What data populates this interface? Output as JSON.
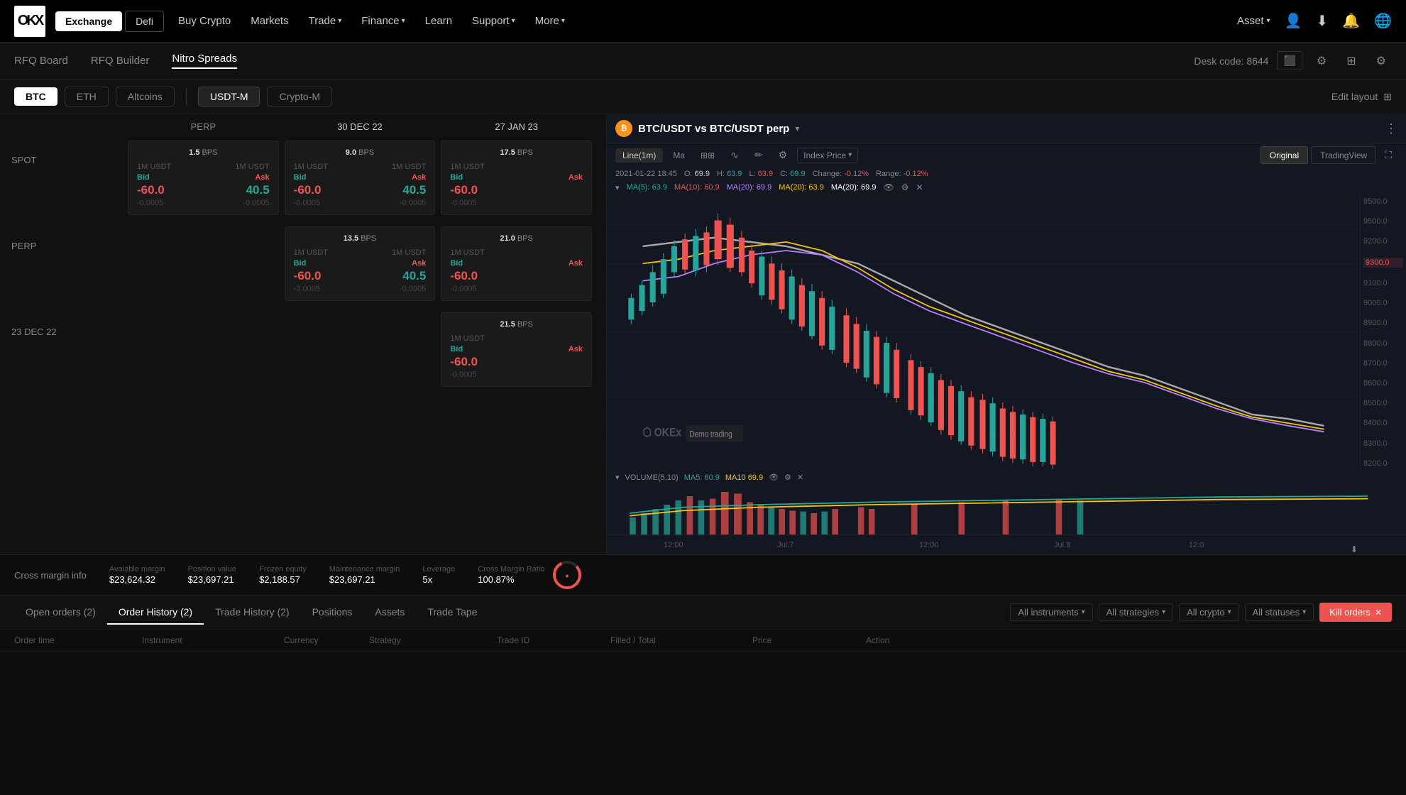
{
  "nav": {
    "logo": "OKX",
    "tabs": [
      {
        "label": "Exchange",
        "active": true
      },
      {
        "label": "Defi",
        "active": false
      }
    ],
    "links": [
      {
        "label": "Buy Crypto",
        "hasDropdown": false
      },
      {
        "label": "Markets",
        "hasDropdown": false
      },
      {
        "label": "Trade",
        "hasDropdown": true
      },
      {
        "label": "Finance",
        "hasDropdown": true
      },
      {
        "label": "Learn",
        "hasDropdown": false
      },
      {
        "label": "Support",
        "hasDropdown": true
      },
      {
        "label": "More",
        "hasDropdown": true
      }
    ],
    "right": {
      "asset": "Asset",
      "icons": [
        "user",
        "download",
        "bell",
        "globe"
      ]
    }
  },
  "subNav": {
    "items": [
      {
        "label": "RFQ Board",
        "active": false
      },
      {
        "label": "RFQ Builder",
        "active": false
      },
      {
        "label": "Nitro Spreads",
        "active": true
      }
    ],
    "deskCode": "Desk code: 8644"
  },
  "filterBar": {
    "filters": [
      {
        "label": "BTC",
        "active": true
      },
      {
        "label": "ETH",
        "active": false
      },
      {
        "label": "Altcoins",
        "active": false
      }
    ],
    "marginFilters": [
      {
        "label": "USDT-M",
        "active": true
      },
      {
        "label": "Crypto-M",
        "active": false
      }
    ],
    "editLayout": "Edit layout"
  },
  "spreadTable": {
    "colHeaders": [
      "PERP",
      "30 DEC 22",
      "27 JAN 23"
    ],
    "rows": [
      {
        "label": "SPOT",
        "cells": [
          {
            "col": 0,
            "bps": "1.5",
            "unit": "1M USDT",
            "bid_label": "Bid",
            "ask_label": "Ask",
            "bid_unit": "1M USDT",
            "ask_unit": "1M USDT",
            "bid_val": "-60.0",
            "ask_val": "40.5",
            "bid_sub": "-0.0005",
            "ask_sub": "-0.0005"
          },
          {
            "col": 1,
            "bps": "9.0",
            "unit": "1M USDT",
            "bid_label": "Bid",
            "ask_label": "Ask",
            "bid_unit": "1M USDT",
            "ask_unit": "1M USDT",
            "bid_val": "-60.0",
            "ask_val": "40.5",
            "bid_sub": "-0.0005",
            "ask_sub": "-0.0005"
          },
          {
            "col": 2,
            "bps": "17.5",
            "unit": "1M USDT",
            "bid_label": "Bid",
            "ask_label": "Ask",
            "bid_unit": "1M USDT",
            "ask_unit": "1M USDT",
            "bid_val": "-60.0",
            "ask_val": "",
            "bid_sub": "-0.0005",
            "ask_sub": ""
          }
        ]
      },
      {
        "label": "PERP",
        "cells": [
          {
            "col": 1,
            "bps": "13.5",
            "unit": "1M USDT",
            "bid_label": "Bid",
            "ask_label": "Ask",
            "bid_unit": "1M USDT",
            "ask_unit": "1M USDT",
            "bid_val": "-60.0",
            "ask_val": "40.5",
            "bid_sub": "-0.0005",
            "ask_sub": "-0.0005"
          },
          {
            "col": 2,
            "bps": "21.0",
            "unit": "1M USDT",
            "bid_label": "Bid",
            "ask_label": "Ask",
            "bid_unit": "1M USDT",
            "ask_unit": "1M USDT",
            "bid_val": "-60.0",
            "ask_val": "",
            "bid_sub": "-0.0005",
            "ask_sub": ""
          }
        ]
      },
      {
        "label": "23 DEC 22",
        "cells": [
          {
            "col": 2,
            "bps": "21.5",
            "unit": "1M USDT",
            "bid_label": "Bid",
            "ask_label": "Ask",
            "bid_unit": "1M USDT",
            "ask_unit": "1M USDT",
            "bid_val": "-60.0",
            "ask_val": "",
            "bid_sub": "-0.0005",
            "ask_sub": ""
          }
        ]
      }
    ]
  },
  "chart": {
    "symbol": "BTC/USDT vs BTC/USDT perp",
    "timeframe": "Line(1m)",
    "indicator": "Ma",
    "datetime": "2021-01-22 18:45",
    "open": "69.9",
    "high": "63.9",
    "low": "63.9",
    "close": "69.9",
    "change": "-0.12%",
    "range": "-0.12%",
    "ma5": "63.9",
    "ma10": "60.9",
    "ma20_1": "69.9",
    "ma20_2": "63.9",
    "ma20_3": "69.9",
    "indexPrice": "Index Price",
    "viewButtons": [
      {
        "label": "Original",
        "active": true
      },
      {
        "label": "TradingView",
        "active": false
      }
    ],
    "priceScale": [
      "9500.0",
      "9500.0",
      "9200.0",
      "9300.0",
      "9100.0",
      "9000.0",
      "8900.0",
      "8800.0",
      "8700.0",
      "8600.0",
      "8500.0",
      "8400.0",
      "8300.0",
      "8200.0"
    ],
    "currentPrice": "9300.0",
    "watermark": "OKEx",
    "demoLabel": "Demo trading",
    "volumeInfo": "VOLUME(5,10)",
    "volMa5": "60.9",
    "volMa10": "69.9",
    "timeLabels": [
      "12:00",
      "Jul.7",
      "12:00",
      "Jul.8",
      "12:0"
    ]
  },
  "crossMargin": {
    "label": "Cross margin info",
    "items": [
      {
        "label": "Avaiable margin",
        "value": "$23,624.32"
      },
      {
        "label": "Position value",
        "value": "$23,697.21"
      },
      {
        "label": "Frozen equity",
        "value": "$2,188.57"
      },
      {
        "label": "Maintenance margin",
        "value": "$23,697.21"
      },
      {
        "label": "Leverage",
        "value": "5x"
      },
      {
        "label": "Cross Margin Ratio",
        "value": "100.87%"
      }
    ]
  },
  "bottomTabs": {
    "tabs": [
      {
        "label": "Open orders (2)",
        "active": false
      },
      {
        "label": "Order History (2)",
        "active": true
      },
      {
        "label": "Trade History (2)",
        "active": false
      },
      {
        "label": "Positions",
        "active": false
      },
      {
        "label": "Assets",
        "active": false
      },
      {
        "label": "Trade Tape",
        "active": false
      }
    ],
    "filters": [
      {
        "label": "All instruments",
        "hasDropdown": true
      },
      {
        "label": "All strategies",
        "hasDropdown": true
      },
      {
        "label": "All crypto",
        "hasDropdown": true
      },
      {
        "label": "All statuses",
        "hasDropdown": true
      }
    ],
    "killButton": "Kill orders"
  },
  "tableHeaders": [
    "Order time",
    "Instrument",
    "Currency",
    "Strategy",
    "Trade ID",
    "Filled / Total",
    "Price",
    "Action"
  ]
}
